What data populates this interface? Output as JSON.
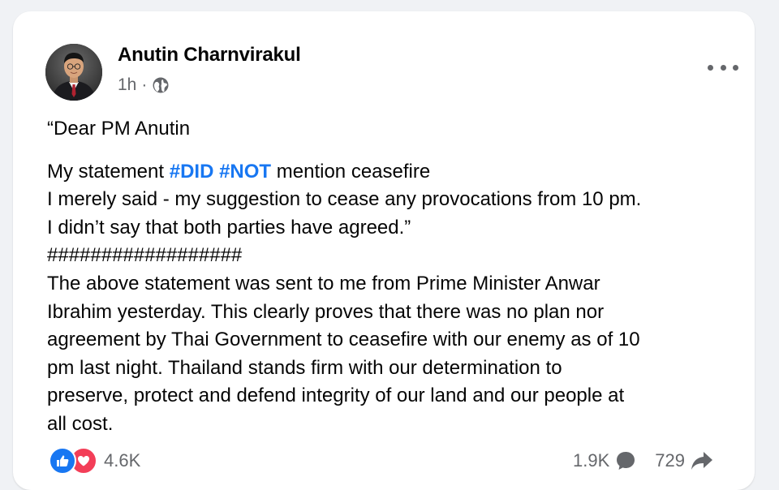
{
  "post": {
    "author": "Anutin Charnvirakul",
    "time": "1h",
    "separator": "·",
    "privacy_icon": "globe-icon",
    "more_icon": "more-options-icon",
    "lines": [
      {
        "kind": "plain",
        "text": "“Dear PM Anutin"
      },
      {
        "kind": "gap"
      },
      {
        "kind": "hashtags",
        "before": "My statement ",
        "tag1": "#DID",
        "between": " ",
        "tag2": "#NOT",
        "after": " mention ceasefire"
      },
      {
        "kind": "plain",
        "text": "I merely said - my suggestion to cease any provocations from 10 pm."
      },
      {
        "kind": "plain",
        "text": "I didn’t say that both parties have agreed.”"
      },
      {
        "kind": "plain",
        "text": "##################"
      },
      {
        "kind": "plain",
        "text": "The above statement was sent to me from Prime Minister Anwar"
      },
      {
        "kind": "plain",
        "text": "Ibrahim yesterday. This clearly proves that there was no plan nor"
      },
      {
        "kind": "plain",
        "text": "agreement by Thai Government to ceasefire with our enemy as of 10"
      },
      {
        "kind": "plain",
        "text": "pm last night. Thailand stands firm with our determination to"
      },
      {
        "kind": "plain",
        "text": "preserve, protect and defend integrity of our land and our people at"
      },
      {
        "kind": "plain",
        "text": "all cost."
      }
    ]
  },
  "engagement": {
    "reactions_count": "4.6K",
    "reaction_icons": [
      "like-icon",
      "love-icon"
    ],
    "comments_count": "1.9K",
    "comments_icon": "comment-bubble-icon",
    "shares_count": "729",
    "shares_icon": "share-arrow-icon"
  },
  "colors": {
    "hashtag": "#1877f2",
    "secondary_text": "#65676b",
    "like_blue": "#1877f2",
    "love_red": "#f33e58",
    "card_bg": "#ffffff",
    "page_bg": "#f0f2f5"
  }
}
